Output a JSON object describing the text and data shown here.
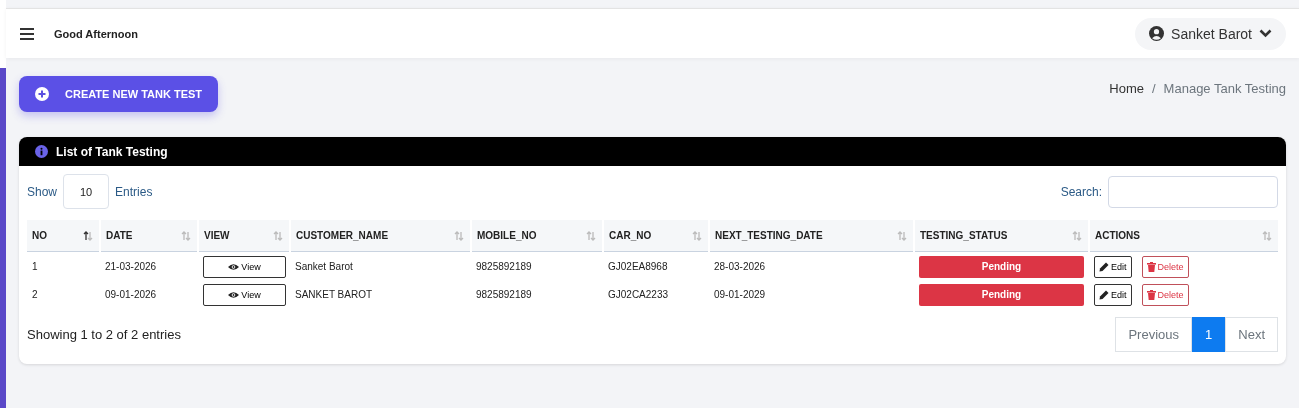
{
  "header": {
    "greeting": "Good Afternoon",
    "user": "Sanket Barot"
  },
  "create_button": "CREATE NEW TANK TEST",
  "breadcrumb": {
    "items": [
      "Home",
      "Manage Tank Testing"
    ],
    "separator": "/"
  },
  "card": {
    "title": "List of Tank Testing",
    "length": {
      "before": "Show",
      "value": "10",
      "after": "Entries"
    },
    "search": {
      "label": "Search:"
    },
    "columns": [
      {
        "label": "NO",
        "sorted": true
      },
      {
        "label": "DATE",
        "sorted": false
      },
      {
        "label": "VIEW",
        "sorted": false
      },
      {
        "label": "CUSTOMER_NAME",
        "sorted": false
      },
      {
        "label": "MOBILE_NO",
        "sorted": false
      },
      {
        "label": "CAR_NO",
        "sorted": false
      },
      {
        "label": "NEXT_TESTING_DATE",
        "sorted": false
      },
      {
        "label": "TESTING_STATUS",
        "sorted": false
      },
      {
        "label": "ACTIONS",
        "sorted": false
      }
    ],
    "rows": [
      {
        "no": "1",
        "date": "21-03-2026",
        "view": "View",
        "customer_name": "Sanket Barot",
        "mobile_no": "9825892189",
        "car_no": "GJ02EA8968",
        "next_testing_date": "28-03-2026",
        "status": {
          "text": "Pending",
          "kind": "danger"
        },
        "edit": "Edit",
        "delete": "Delete"
      },
      {
        "no": "2",
        "date": "09-01-2026",
        "view": "View",
        "customer_name": "SANKET BAROT",
        "mobile_no": "9825892189",
        "car_no": "GJ02CA2233",
        "next_testing_date": "09-01-2029",
        "status": {
          "text": "Pending",
          "kind": "danger"
        },
        "edit": "Edit",
        "delete": "Delete"
      }
    ],
    "info": "Showing 1 to 2 of 2 entries",
    "pagination": [
      {
        "label": "Previous",
        "selected": false
      },
      {
        "label": "1",
        "selected": true
      },
      {
        "label": "Next",
        "selected": false
      }
    ]
  }
}
